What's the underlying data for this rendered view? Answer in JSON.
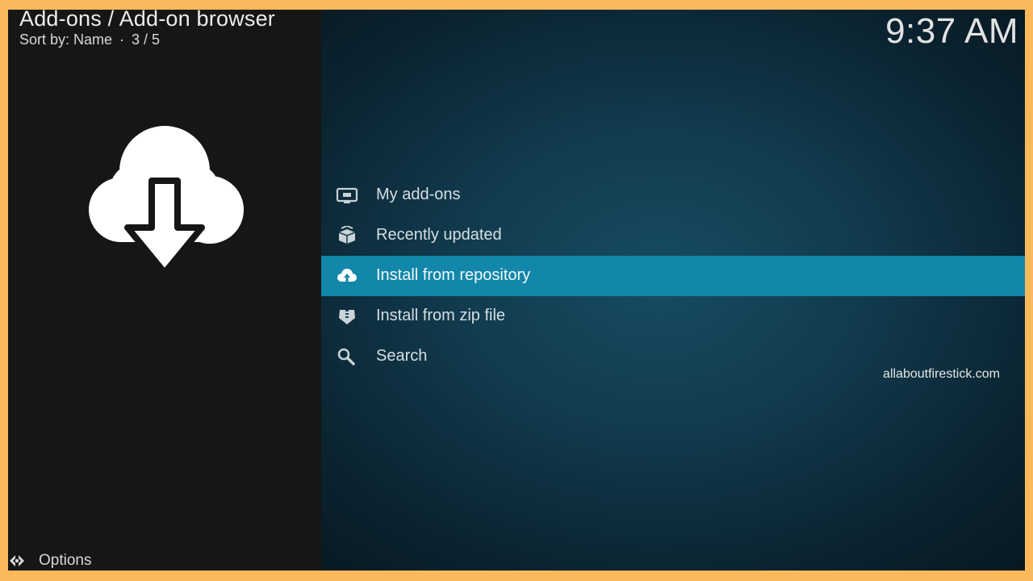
{
  "header": {
    "breadcrumb": "Add-ons / Add-on browser",
    "sort_label": "Sort by: Name",
    "separator": "·",
    "position": "3 / 5",
    "clock": "9:37 AM"
  },
  "hero_icon": "cloud-download-icon",
  "menu": {
    "items": [
      {
        "label": "My add-ons",
        "icon": "monitor-icon",
        "selected": false
      },
      {
        "label": "Recently updated",
        "icon": "box-icon",
        "selected": false
      },
      {
        "label": "Install from repository",
        "icon": "cloud-upload-icon",
        "selected": true
      },
      {
        "label": "Install from zip file",
        "icon": "zip-icon",
        "selected": false
      },
      {
        "label": "Search",
        "icon": "search-icon",
        "selected": false
      }
    ]
  },
  "watermark": "allaboutfirestick.com",
  "footer": {
    "options_label": "Options",
    "options_icon": "options-icon"
  },
  "colors": {
    "selected_row": "#1287aa",
    "frame_border": "#fbb95c",
    "left_panel": "#161616",
    "right_panel": "#113a4d"
  }
}
